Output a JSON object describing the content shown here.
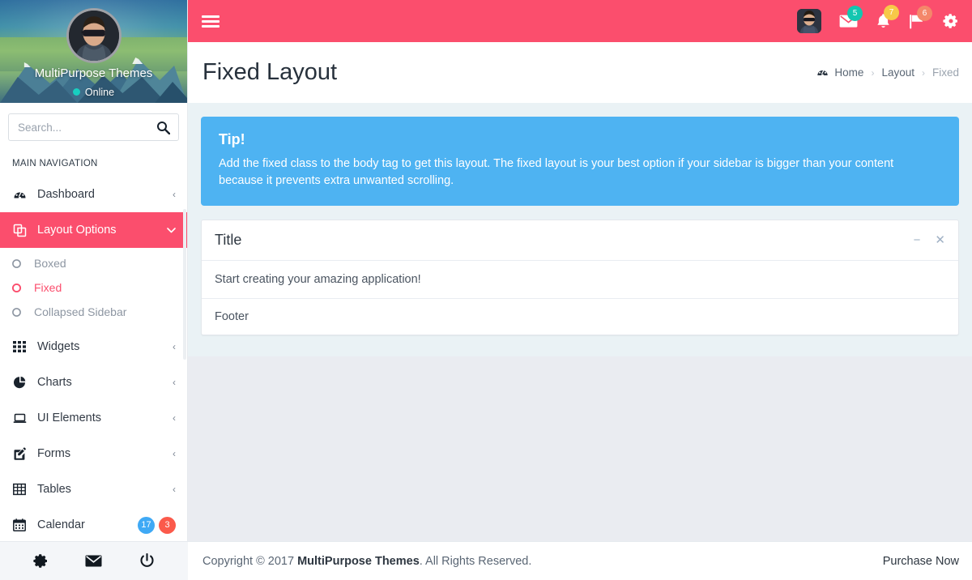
{
  "colors": {
    "brand_pink": "#fb4e6d",
    "tip_blue": "#4eb3f2",
    "badge_teal": "#13c6b0",
    "badge_yellow": "#f7c948",
    "badge_orange": "#f4876a",
    "badge_blue": "#3fa9f5",
    "badge_red": "#fb5a4b",
    "online_green": "#18cfc0"
  },
  "sidebar": {
    "profile_name": "MultiPurpose Themes",
    "status": "Online",
    "avatar_icon": "user-avatar-photo",
    "search": {
      "placeholder": "Search...",
      "value": "",
      "icon": "search-icon"
    },
    "nav_title": "MAIN NAVIGATION",
    "items": [
      {
        "label": "Dashboard",
        "icon": "dashboard-icon",
        "caret": "‹",
        "active": false
      },
      {
        "label": "Layout Options",
        "icon": "layers-icon",
        "caret": "∨",
        "active": true
      },
      {
        "label": "Widgets",
        "icon": "grid-icon",
        "caret": "‹",
        "active": false
      },
      {
        "label": "Charts",
        "icon": "pie-chart-icon",
        "caret": "‹",
        "active": false
      },
      {
        "label": "UI Elements",
        "icon": "laptop-icon",
        "caret": "‹",
        "active": false
      },
      {
        "label": "Forms",
        "icon": "edit-pencil-icon",
        "caret": "‹",
        "active": false
      },
      {
        "label": "Tables",
        "icon": "table-icon",
        "caret": "‹",
        "active": false
      },
      {
        "label": "Calendar",
        "icon": "calendar-icon",
        "badges": [
          "17",
          "3"
        ]
      }
    ],
    "sub_items": [
      {
        "label": "Boxed",
        "active": false
      },
      {
        "label": "Fixed",
        "active": true
      },
      {
        "label": "Collapsed Sidebar",
        "active": false
      }
    ],
    "footer_icons": [
      "gear-icon",
      "envelope-icon",
      "power-icon"
    ]
  },
  "topbar": {
    "menu_toggle_icon": "hamburger-menu-icon",
    "avatar_icon": "user-avatar-photo",
    "actions": [
      {
        "icon": "envelope-icon",
        "badge": "5",
        "badge_color": "tb-teal"
      },
      {
        "icon": "bell-icon",
        "badge": "7",
        "badge_color": "tb-yellow"
      },
      {
        "icon": "flag-icon",
        "badge": "6",
        "badge_color": "tb-orange"
      },
      {
        "icon": "gear-icon",
        "badge": "",
        "badge_color": ""
      }
    ]
  },
  "pagehead": {
    "title": "Fixed Layout",
    "breadcrumb": {
      "home_icon": "dashboard-icon",
      "home": "Home",
      "sep": "›",
      "middle": "Layout",
      "current": "Fixed"
    }
  },
  "tip": {
    "title": "Tip!",
    "text": "Add the fixed class to the body tag to get this layout. The fixed layout is your best option if your sidebar is bigger than your content because it prevents extra unwanted scrolling."
  },
  "card": {
    "title": "Title",
    "minimize_icon": "minimize-icon",
    "close_icon": "close-icon",
    "minimize_glyph": "−",
    "close_glyph": "✕",
    "body": "Start creating your amazing application!",
    "footer": "Footer"
  },
  "footer": {
    "copyright_prefix": "Copyright © 2017 ",
    "brand": "MultiPurpose Themes",
    "copyright_suffix": ". All Rights Reserved.",
    "purchase": "Purchase Now"
  }
}
